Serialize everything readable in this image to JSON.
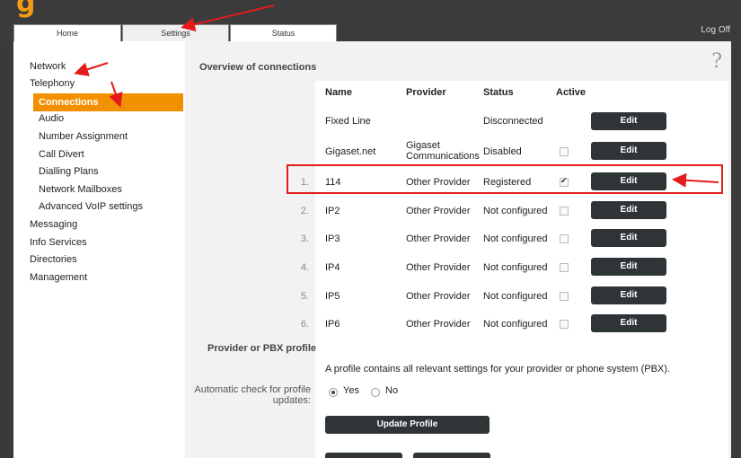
{
  "app": {
    "logo_text": "g"
  },
  "tabs": [
    {
      "label": "Home"
    },
    {
      "label": "Settings"
    },
    {
      "label": "Status"
    }
  ],
  "logoff_label": "Log Off",
  "sidebar": {
    "items": [
      {
        "label": "Network"
      },
      {
        "label": "Telephony"
      },
      {
        "label": "Connections"
      },
      {
        "label": "Audio"
      },
      {
        "label": "Number Assignment"
      },
      {
        "label": "Call Divert"
      },
      {
        "label": "Dialling Plans"
      },
      {
        "label": "Network Mailboxes"
      },
      {
        "label": "Advanced VoIP settings"
      },
      {
        "label": "Messaging"
      },
      {
        "label": "Info Services"
      },
      {
        "label": "Directories"
      },
      {
        "label": "Management"
      }
    ]
  },
  "main": {
    "help_glyph": "?",
    "overview_title": "Overview of connections",
    "columns": {
      "name": "Name",
      "provider": "Provider",
      "status": "Status",
      "active": "Active"
    },
    "edit_label": "Edit",
    "rows": [
      {
        "index": "",
        "name": "Fixed Line",
        "provider": "",
        "status": "Disconnected",
        "active": null
      },
      {
        "index": "",
        "name": "Gigaset.net",
        "provider": "Gigaset Communications",
        "status": "Disabled",
        "active": false
      },
      {
        "index": "1.",
        "name": "114",
        "provider": "Other Provider",
        "status": "Registered",
        "active": true
      },
      {
        "index": "2.",
        "name": "IP2",
        "provider": "Other Provider",
        "status": "Not configured",
        "active": false
      },
      {
        "index": "3.",
        "name": "IP3",
        "provider": "Other Provider",
        "status": "Not configured",
        "active": false
      },
      {
        "index": "4.",
        "name": "IP4",
        "provider": "Other Provider",
        "status": "Not configured",
        "active": false
      },
      {
        "index": "5.",
        "name": "IP5",
        "provider": "Other Provider",
        "status": "Not configured",
        "active": false
      },
      {
        "index": "6.",
        "name": "IP6",
        "provider": "Other Provider",
        "status": "Not configured",
        "active": false
      }
    ],
    "profile_title": "Provider or PBX profile",
    "profile_desc": "A profile contains all relevant settings for your provider or phone system (PBX).",
    "auto_check_label": "Automatic check for profile updates:",
    "radio_yes": "Yes",
    "radio_no": "No",
    "auto_check_value": "Yes",
    "update_profile_label": "Update Profile"
  },
  "colors": {
    "accent": "#f29000",
    "annotation": "#e31b1b",
    "button": "#2f3436"
  }
}
